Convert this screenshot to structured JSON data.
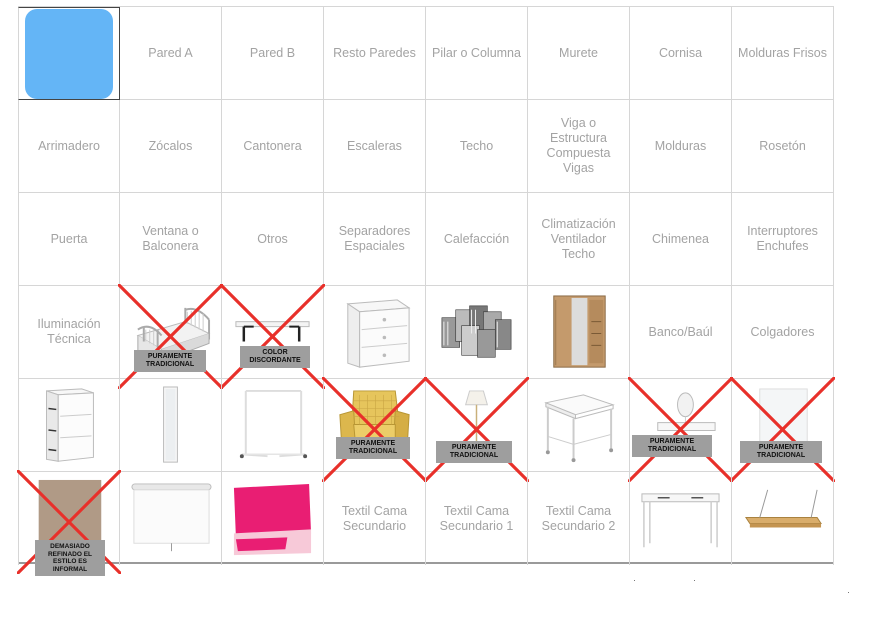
{
  "swatch_color": "#64b5f6",
  "cross_color": "#e8302a",
  "cells": {
    "r1": [
      "Pared A",
      "Pared B",
      "Resto Paredes",
      "Pilar o Columna",
      "Murete",
      "Cornisa",
      "Molduras Frisos"
    ],
    "r2": [
      "Arrimadero",
      "Zócalos",
      "Cantonera",
      "Escaleras",
      "Techo",
      "Viga o Estructura Compuesta Vigas",
      "Molduras",
      "Rosetón"
    ],
    "r3": [
      "Puerta",
      "Ventana o Balconera",
      "Otros",
      "Separadores Espaciales",
      "Calefacción",
      "Climatización Ventilador Techo",
      "Chimenea",
      "Interruptores Enchufes"
    ],
    "r4": [
      "Iluminación Técnica",
      "Banco/Baúl",
      "Colgadores"
    ],
    "r6": [
      "Textil Cama Secundario",
      "Textil Cama Secundario 1",
      "Textil Cama Secundario 2"
    ]
  },
  "tags": {
    "bed": "PURAMENTE TRADICIONAL",
    "shelf": "COLOR DISCORDANTE",
    "armchair": "PURAMENTE TRADICIONAL",
    "lamp": "PURAMENTE TRADICIONAL",
    "vanity": "PURAMENTE TRADICIONAL",
    "mirror": "PURAMENTE TRADICIONAL",
    "panel": "DEMASIADO REFINADO EL ESTILO ES INFORMAL"
  }
}
